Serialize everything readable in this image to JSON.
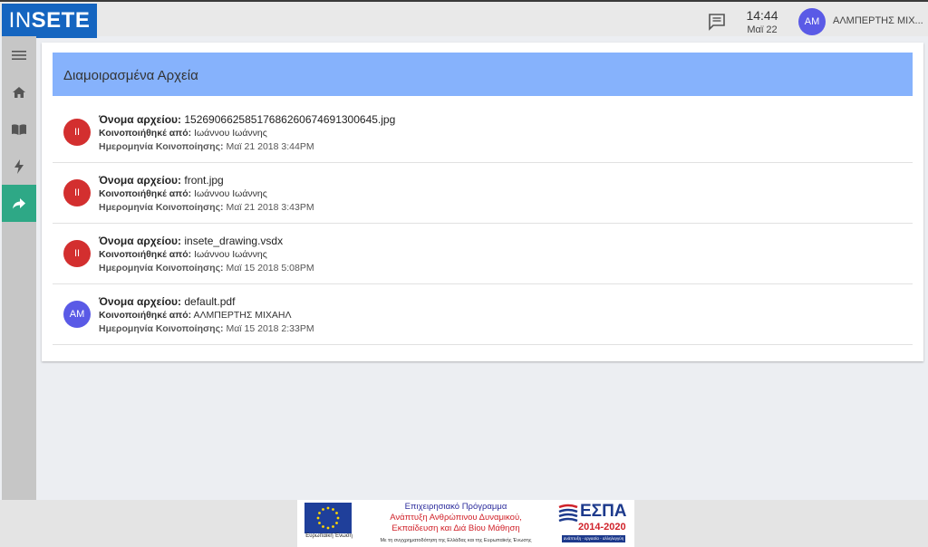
{
  "header": {
    "logo_part1": "IN",
    "logo_part2": "SETE",
    "time": "14:44",
    "date": "Μαϊ 22",
    "user_initials": "AM",
    "user_name": "ΑΛΜΠΕΡΤΗΣ ΜΙΧ..."
  },
  "sidebar": {
    "items": [
      "menu-icon",
      "home-icon",
      "book-icon",
      "bolt-icon",
      "share-icon"
    ],
    "active": "share-icon"
  },
  "page": {
    "title": "Διαμοιρασμένα Αρχεία",
    "label_filename": "Όνομα αρχείου:",
    "label_shared_by": "Κοινοποιήθηκέ από:",
    "label_date": "Ημερομηνία Κοινοποίησης:"
  },
  "files": [
    {
      "initials": "II",
      "avatar_color": "#d32f2f",
      "filename": "15269066258517686260674691300645.jpg",
      "shared_by": "Ιωάννου Ιωάννης",
      "date": "Μαϊ 21 2018 3:44PM"
    },
    {
      "initials": "II",
      "avatar_color": "#d32f2f",
      "filename": "front.jpg",
      "shared_by": "Ιωάννου Ιωάννης",
      "date": "Μαϊ 21 2018 3:43PM"
    },
    {
      "initials": "II",
      "avatar_color": "#d32f2f",
      "filename": "insete_drawing.vsdx",
      "shared_by": "Ιωάννου Ιωάννης",
      "date": "Μαϊ 15 2018 5:08PM"
    },
    {
      "initials": "AM",
      "avatar_color": "#5a5ae6",
      "filename": "default.pdf",
      "shared_by": "ΑΛΜΠΕΡΤΗΣ ΜΙΧΑΗΛ",
      "date": "Μαϊ 15 2018 2:33PM"
    }
  ],
  "footer": {
    "eu_caption": "Ευρωπαϊκή Ένωση",
    "program_line1": "Επιχειρησιακό Πρόγραμμα",
    "program_line2": "Ανάπτυξη Ανθρώπινου Δυναμικού,",
    "program_line3": "Εκπαίδευση και Διά Βίου Μάθηση",
    "program_line4": "Με τη συγχρηματοδότηση της Ελλάδας και της Ευρωπαϊκής Ένωσης",
    "espa_word": "ΕΣΠΑ",
    "espa_years": "2014-2020",
    "espa_tagline": "ανάπτυξη - εργασία - αλληλεγγύη"
  },
  "colors": {
    "accent_active": "#2ea886",
    "header_bar": "#86b2fc",
    "logo_bg": "#1565c0"
  }
}
